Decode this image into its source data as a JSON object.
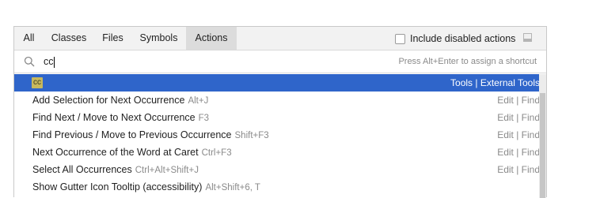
{
  "tabs": [
    {
      "label": "All",
      "selected": false
    },
    {
      "label": "Classes",
      "selected": false
    },
    {
      "label": "Files",
      "selected": false
    },
    {
      "label": "Symbols",
      "selected": false
    },
    {
      "label": "Actions",
      "selected": true
    }
  ],
  "include_disabled": {
    "label": "Include disabled actions",
    "checked": false
  },
  "search": {
    "value": "cc",
    "hint": "Press Alt+Enter to assign a shortcut"
  },
  "results": [
    {
      "name": "cc",
      "shortcut": "",
      "location": "Tools | External Tools",
      "selected": true,
      "badge": true
    },
    {
      "name": "Add Selection for Next Occurrence",
      "shortcut": "Alt+J",
      "location": "Edit | Find"
    },
    {
      "name": "Find Next / Move to Next Occurrence",
      "shortcut": "F3",
      "location": "Edit | Find"
    },
    {
      "name": "Find Previous / Move to Previous Occurrence",
      "shortcut": "Shift+F3",
      "location": "Edit | Find"
    },
    {
      "name": "Next Occurrence of the Word at Caret",
      "shortcut": "Ctrl+F3",
      "location": "Edit | Find"
    },
    {
      "name": "Select All Occurrences",
      "shortcut": "Ctrl+Alt+Shift+J",
      "location": "Edit | Find"
    },
    {
      "name": "Show Gutter Icon Tooltip (accessibility)",
      "shortcut": "Alt+Shift+6, T",
      "location": ""
    }
  ],
  "icons": {
    "search": "search-icon",
    "open_in_window": "open-in-window-icon"
  },
  "colors": {
    "selection": "#2f65ca",
    "badge": "#c7b85d",
    "tab_selected": "#dcdcdc"
  }
}
